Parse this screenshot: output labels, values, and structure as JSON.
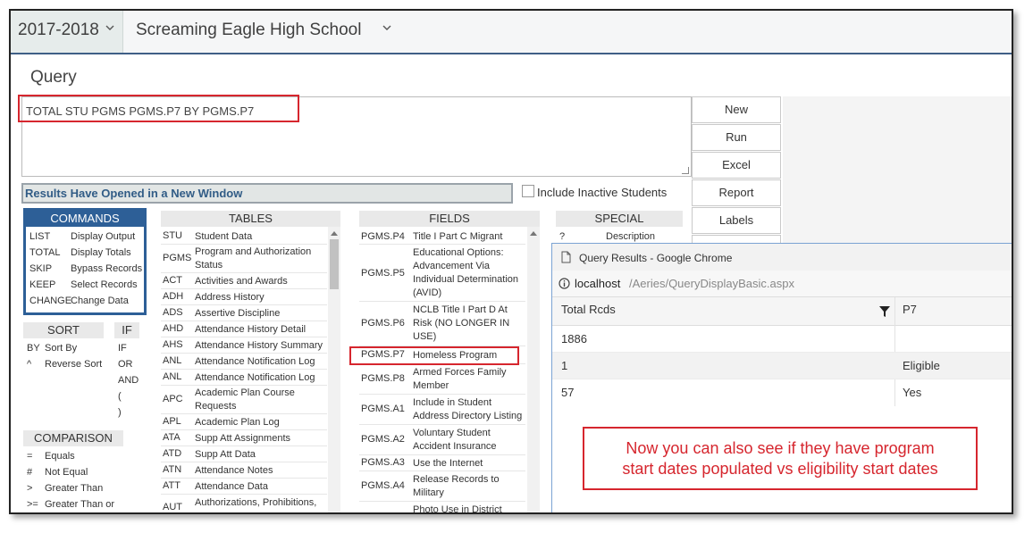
{
  "header": {
    "year": "2017-2018",
    "school": "Screaming Eagle High School"
  },
  "query": {
    "title": "Query",
    "text": "TOTAL STU PGMS PGMS.P7 BY PGMS.P7"
  },
  "buttons": {
    "new": "New",
    "run": "Run",
    "excel": "Excel",
    "report": "Report",
    "labels": "Labels"
  },
  "status": {
    "message": "Results Have Opened in a New Window",
    "include_inactive": "Include Inactive Students"
  },
  "commands": {
    "title": "COMMANDS",
    "items": [
      {
        "code": "LIST",
        "desc": "Display Output"
      },
      {
        "code": "TOTAL",
        "desc": "Display Totals"
      },
      {
        "code": "SKIP",
        "desc": "Bypass Records"
      },
      {
        "code": "KEEP",
        "desc": "Select Records"
      },
      {
        "code": "CHANGE",
        "desc": "Change Data"
      }
    ]
  },
  "sort": {
    "title": "SORT",
    "items": [
      {
        "code": "BY",
        "desc": "Sort By"
      },
      {
        "code": "^",
        "desc": "Reverse Sort"
      }
    ]
  },
  "if": {
    "title": "IF",
    "items": [
      "IF",
      "OR",
      "AND",
      "(",
      ")"
    ]
  },
  "comparison": {
    "title": "COMPARISON",
    "items": [
      {
        "code": "=",
        "desc": "Equals"
      },
      {
        "code": "#",
        "desc": "Not Equal"
      },
      {
        "code": ">",
        "desc": "Greater Than"
      },
      {
        "code": ">=",
        "desc": "Greater Than or"
      }
    ]
  },
  "tables": {
    "title": "TABLES",
    "items": [
      {
        "code": "STU",
        "desc": "Student Data"
      },
      {
        "code": "PGMS",
        "desc": "Program and Authorization Status"
      },
      {
        "code": "ACT",
        "desc": "Activities and Awards"
      },
      {
        "code": "ADH",
        "desc": "Address History"
      },
      {
        "code": "ADS",
        "desc": "Assertive Discipline"
      },
      {
        "code": "AHD",
        "desc": "Attendance History Detail"
      },
      {
        "code": "AHS",
        "desc": "Attendance History Summary"
      },
      {
        "code": "ANL",
        "desc": "Attendance Notification Log"
      },
      {
        "code": "ANL",
        "desc": "Attendance Notification Log"
      },
      {
        "code": "APC",
        "desc": "Academic Plan Course Requests"
      },
      {
        "code": "APL",
        "desc": "Academic Plan Log"
      },
      {
        "code": "ATA",
        "desc": "Supp Att Assignments"
      },
      {
        "code": "ATD",
        "desc": "Supp Att Data"
      },
      {
        "code": "ATN",
        "desc": "Attendance Notes"
      },
      {
        "code": "ATT",
        "desc": "Attendance Data"
      },
      {
        "code": "AUT",
        "desc": "Authorizations, Prohibitions,"
      }
    ]
  },
  "fields": {
    "title": "FIELDS",
    "items": [
      {
        "code": "PGMS.P4",
        "desc": "Title I Part C Migrant"
      },
      {
        "code": "PGMS.P5",
        "desc": "Educational Options: Advancement Via Individual Determination (AVID)"
      },
      {
        "code": "PGMS.P6",
        "desc": "NCLB Title I Part D At Risk (NO LONGER IN USE)"
      },
      {
        "code": "PGMS.P7",
        "desc": "Homeless Program"
      },
      {
        "code": "PGMS.P8",
        "desc": "Armed Forces Family Member"
      },
      {
        "code": "PGMS.A1",
        "desc": "Include in Student Address Directory Listing"
      },
      {
        "code": "PGMS.A2",
        "desc": "Voluntary Student Accident Insurance"
      },
      {
        "code": "PGMS.A3",
        "desc": "Use the Internet"
      },
      {
        "code": "PGMS.A4",
        "desc": "Release Records to Military"
      },
      {
        "code": "",
        "desc": "Photo Use in District"
      }
    ]
  },
  "special": {
    "title": "SPECIAL",
    "items": [
      {
        "code": "?",
        "desc": "Description"
      }
    ]
  },
  "popup": {
    "window_title": "Query Results - Google Chrome",
    "url_host": "localhost",
    "url_path": "/Aeries/QueryDisplayBasic.aspx",
    "columns": [
      "Total Rcds",
      "P7"
    ],
    "rows": [
      [
        "1886",
        ""
      ],
      [
        "1",
        "Eligible"
      ],
      [
        "57",
        "Yes"
      ]
    ]
  },
  "annotation": {
    "line1": "Now you can also see if they have program",
    "line2": "start dates populated vs eligibility start dates"
  }
}
